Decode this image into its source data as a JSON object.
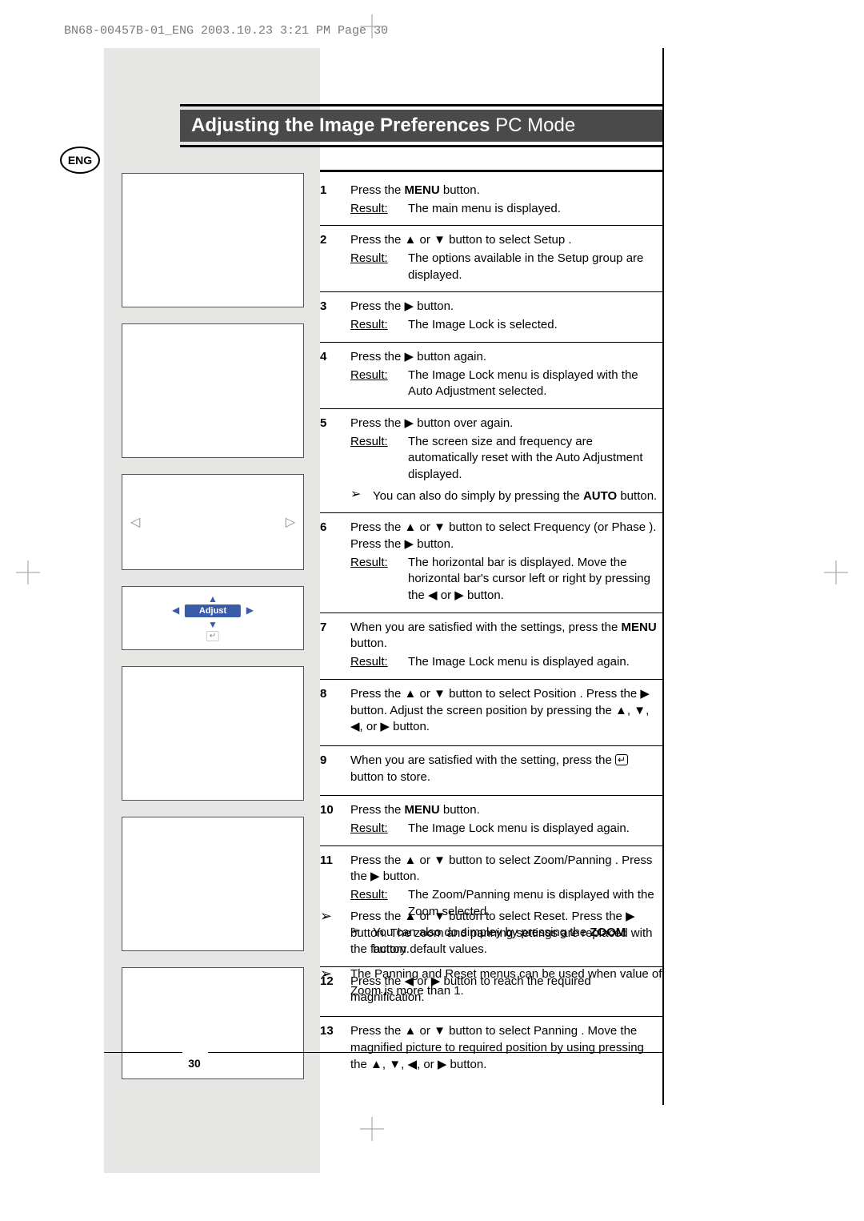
{
  "header_line": "BN68-00457B-01_ENG  2003.10.23  3:21 PM  Page 30",
  "lang_badge": "ENG",
  "title_bold": "Adjusting the Image Preferences",
  "title_light": " PC Mode",
  "adjust_label": "Adjust",
  "result_label": "Result:",
  "page_number": "30",
  "steps": [
    {
      "num": "1",
      "line": "Press the <b class='kw'>MENU</b> button.",
      "result": "The main menu is displayed."
    },
    {
      "num": "2",
      "line": "Press the <span class='tri'>▲</span> or <span class='tri'>▼</span> button to select Setup .",
      "result": "The options available in the Setup  group are displayed."
    },
    {
      "num": "3",
      "line": "Press the <span class='tri'>▶</span> button.",
      "result": "The Image Lock    is selected."
    },
    {
      "num": "4",
      "line": "Press the <span class='tri'>▶</span> button again.",
      "result": "The Image Lock    menu is displayed with the Auto Adjustment    selected."
    },
    {
      "num": "5",
      "line": "Press the <span class='tri'>▶</span> button over again.",
      "result": "The screen size and frequency are automatically reset with the  Auto Adjustment        displayed.",
      "note": "You can also do simply by pressing the <b class='kw'>AUTO</b> button."
    },
    {
      "num": "6",
      "line": "Press the <span class='tri'>▲</span> or <span class='tri'>▼</span> button to select Frequency   (or Phase ). Press the <span class='tri'>▶</span> button.",
      "result": "The horizontal bar is displayed. Move the horizontal bar's cursor left or right by pressing the <span class='tri'>◀</span> or <span class='tri'>▶</span> button."
    },
    {
      "num": "7",
      "line": "When you are satisfied with the settings, press the <b class='kw'>MENU</b> button.",
      "result": "The Image Lock     menu is displayed again."
    },
    {
      "num": "8",
      "line": "Press the <span class='tri'>▲</span> or <span class='tri'>▼</span> button to select Position     . Press the <span class='tri'>▶</span> button. Adjust the screen position by pressing the <span class='tri'>▲</span>, <span class='tri'>▼</span>, <span class='tri'>◀</span>, or <span class='tri'>▶</span> button."
    },
    {
      "num": "9",
      "line": "When you are satisfied with the setting, press the  <span class='enter-icon'>↵</span>  button to store."
    },
    {
      "num": "10",
      "line": "Press the <b class='kw'>MENU</b> button.",
      "result": "The Image Lock     menu is displayed again."
    },
    {
      "num": "11",
      "line": "Press the <span class='tri'>▲</span> or <span class='tri'>▼</span> button to select Zoom/Panning  . Press the <span class='tri'>▶</span> button.",
      "result": "The Zoom/Panning    menu is displayed with the Zoom selected.",
      "note": "You can also do simpley by pressing the <b class='kw'>ZOOM</b> button."
    },
    {
      "num": "12",
      "line": "Press the <span class='tri'>◀</span> or <span class='tri'>▶</span> button to reach the required magnification."
    },
    {
      "num": "13",
      "line": "Press the <span class='tri'>▲</span> or <span class='tri'>▼</span> button to select Panning  . Move the magnified picture to required position by using pressing the <span class='tri'>▲</span>, <span class='tri'>▼</span>, <span class='tri'>◀</span>, or <span class='tri'>▶</span> button."
    }
  ],
  "bottom_notes": [
    "Press the <span class='tri'>▲</span> or <span class='tri'>▼</span> button to select Reset. Press the <span class='tri'>▶</span> button. The zoom and panning settings are replaced with the factory default values.",
    "The  Panning   and  Reset   menus can be used when value of Zoom  is more than 1."
  ]
}
